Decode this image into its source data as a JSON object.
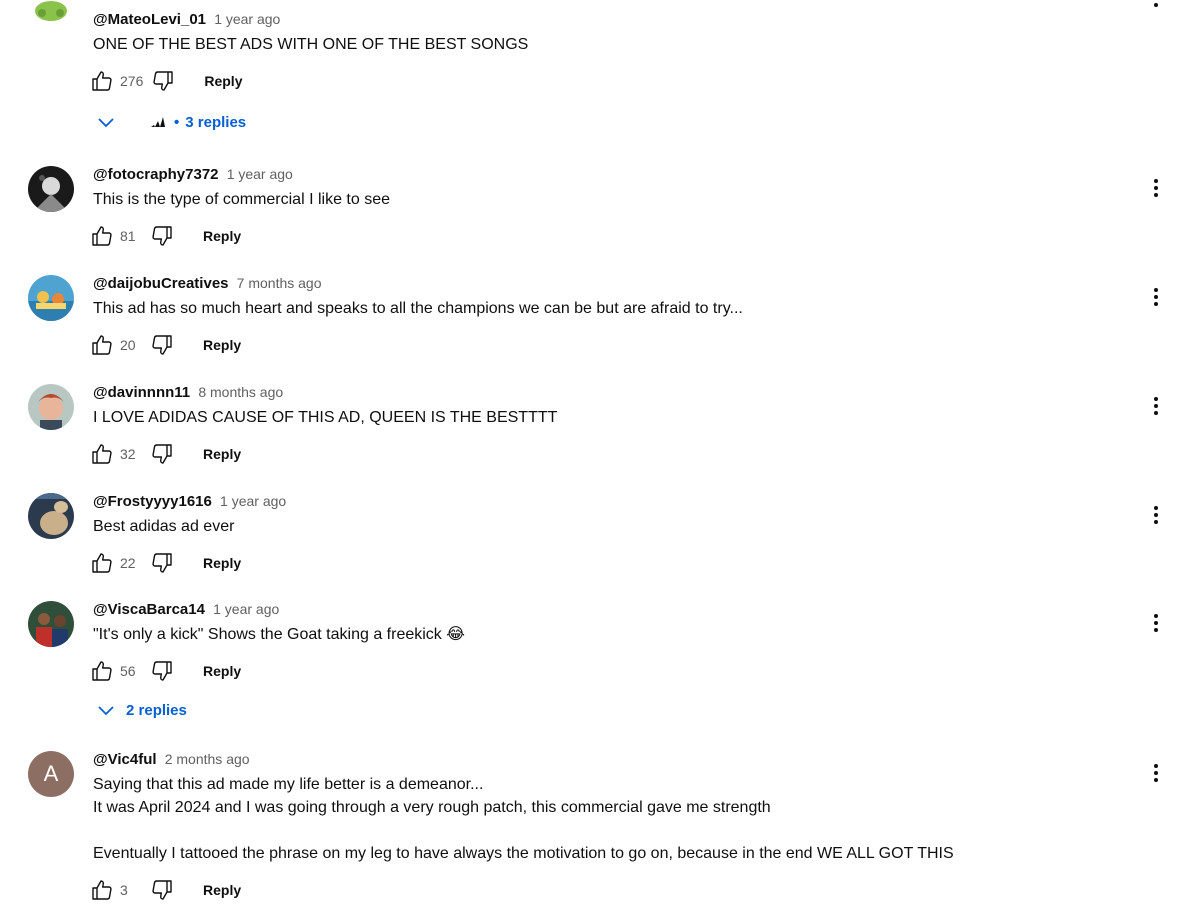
{
  "comments": [
    {
      "author": "@MateoLevi_01",
      "time": "1 year ago",
      "text": "ONE OF THE BEST ADS WITH ONE OF THE BEST SONGS",
      "likes": "276",
      "reply_label": "Reply",
      "replies_label": "3 replies"
    },
    {
      "author": "@fotocraphy7372",
      "time": "1 year ago",
      "text": "This is the type of commercial I like to see",
      "likes": "81",
      "reply_label": "Reply"
    },
    {
      "author": "@daijobuCreatives",
      "time": "7 months ago",
      "text": "This ad has so much heart and speaks to all the champions we can be but are afraid to try...",
      "likes": "20",
      "reply_label": "Reply"
    },
    {
      "author": "@davinnnn11",
      "time": "8 months ago",
      "text": "I LOVE ADIDAS CAUSE OF THIS AD, QUEEN IS THE BESTTTT",
      "likes": "32",
      "reply_label": "Reply"
    },
    {
      "author": "@Frostyyyy1616",
      "time": "1 year ago",
      "text": "Best adidas ad ever",
      "likes": "22",
      "reply_label": "Reply"
    },
    {
      "author": "@ViscaBarca14",
      "time": "1 year ago",
      "text": "\"It's only a kick\" Shows the Goat taking a freekick 😂",
      "likes": "56",
      "reply_label": "Reply",
      "replies_label": "2 replies"
    },
    {
      "author": "@Vic4ful",
      "time": "2 months ago",
      "avatar_letter": "A",
      "text": "Saying that this ad made my life better is a demeanor...\nIt was April 2024 and I was going through a very rough patch, this commercial gave me strength\n\nEventually I tattooed the phrase on my leg to have always the motivation to go on, because in the end WE ALL GOT THIS",
      "likes": "3",
      "reply_label": "Reply"
    }
  ],
  "icons": {
    "like": "thumbs-up-icon",
    "dislike": "thumbs-down-icon",
    "more": "more-vert-icon",
    "expand": "chevron-down-icon"
  },
  "colors": {
    "link_blue": "#065fd4",
    "secondary_text": "#606060",
    "avatar_letter_bg": "#8d6e63"
  }
}
